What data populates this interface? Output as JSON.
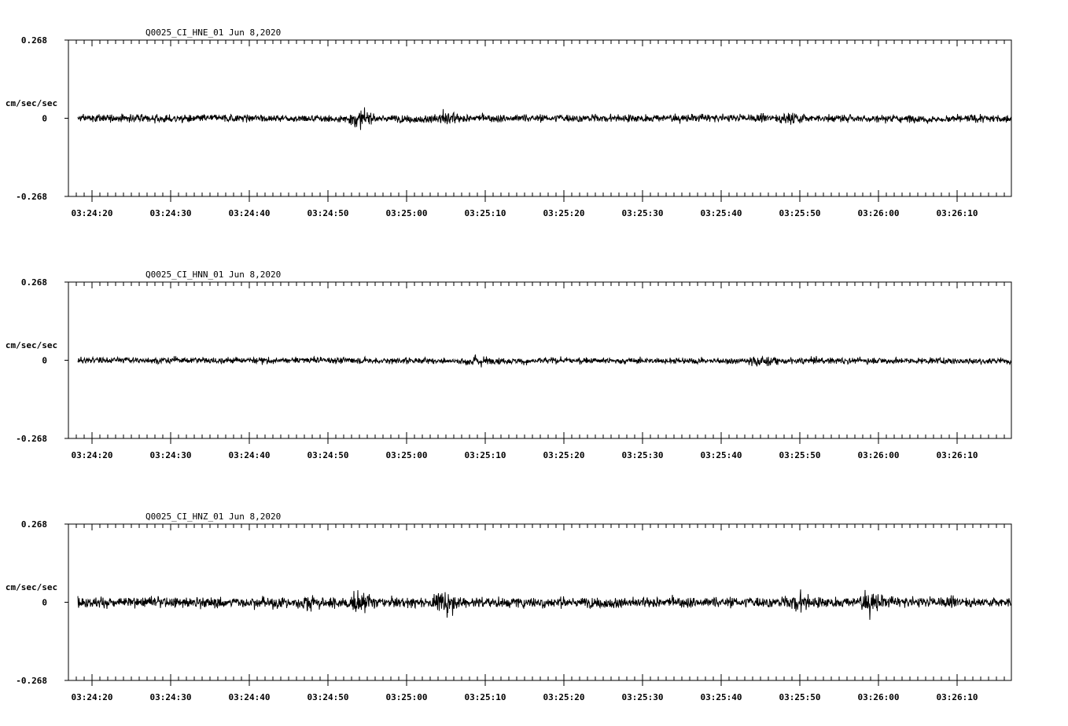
{
  "chart_data": [
    {
      "type": "line",
      "title": "Q0025_CI_HNE_01  Jun 8,2020",
      "ylabel": "cm/sec/sec",
      "ylim": [
        -0.268,
        0.268
      ],
      "ytick_labels": [
        "0.268",
        "0",
        "-0.268"
      ],
      "xtick_labels": [
        "03:24:20",
        "03:24:30",
        "03:24:40",
        "03:24:50",
        "03:25:00",
        "03:25:10",
        "03:25:20",
        "03:25:30",
        "03:25:40",
        "03:25:50",
        "03:26:00",
        "03:26:10"
      ],
      "x_start": "03:24:18",
      "x_end": "03:26:17",
      "noise_amplitude": 0.022,
      "bursts": [
        {
          "t": "03:24:54",
          "amp": 0.03
        },
        {
          "t": "03:25:05",
          "amp": 0.028
        },
        {
          "t": "03:25:49",
          "amp": 0.03
        }
      ],
      "color": "#000000",
      "grid": false
    },
    {
      "type": "line",
      "title": "Q0025_CI_HNN_01  Jun 8,2020",
      "ylabel": "cm/sec/sec",
      "ylim": [
        -0.268,
        0.268
      ],
      "ytick_labels": [
        "0.268",
        "0",
        "-0.268"
      ],
      "xtick_labels": [
        "03:24:20",
        "03:24:30",
        "03:24:40",
        "03:24:50",
        "03:25:00",
        "03:25:10",
        "03:25:20",
        "03:25:30",
        "03:25:40",
        "03:25:50",
        "03:26:00",
        "03:26:10"
      ],
      "x_start": "03:24:18",
      "x_end": "03:26:17",
      "noise_amplitude": 0.018,
      "bursts": [
        {
          "t": "03:25:09",
          "amp": 0.02
        },
        {
          "t": "03:25:45",
          "amp": 0.02
        }
      ],
      "color": "#000000",
      "grid": false
    },
    {
      "type": "line",
      "title": "Q0025_CI_HNZ_01  Jun 8,2020",
      "ylabel": "cm/sec/sec",
      "ylim": [
        -0.268,
        0.268
      ],
      "ytick_labels": [
        "0.268",
        "0",
        "-0.268"
      ],
      "xtick_labels": [
        "03:24:20",
        "03:24:30",
        "03:24:40",
        "03:24:50",
        "03:25:00",
        "03:25:10",
        "03:25:20",
        "03:25:30",
        "03:25:40",
        "03:25:50",
        "03:26:00",
        "03:26:10"
      ],
      "x_start": "03:24:18",
      "x_end": "03:26:17",
      "noise_amplitude": 0.03,
      "bursts": [
        {
          "t": "03:24:48",
          "amp": 0.035
        },
        {
          "t": "03:24:54",
          "amp": 0.04
        },
        {
          "t": "03:25:05",
          "amp": 0.055
        },
        {
          "t": "03:25:50",
          "amp": 0.035
        },
        {
          "t": "03:25:59",
          "amp": 0.04
        }
      ],
      "color": "#000000",
      "grid": false
    }
  ]
}
